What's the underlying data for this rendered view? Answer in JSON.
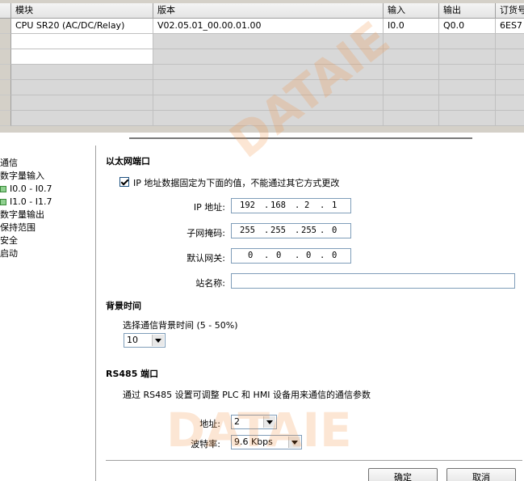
{
  "grid": {
    "headers": [
      "模块",
      "版本",
      "输入",
      "输出",
      "订货号"
    ],
    "rows": [
      [
        "CPU SR20 (AC/DC/Relay)",
        "V02.05.01_00.00.01.00",
        "I0.0",
        "Q0.0",
        "6ES7"
      ],
      [
        "",
        "",
        "",
        "",
        ""
      ],
      [
        "",
        "",
        "",
        "",
        ""
      ],
      [
        "",
        "",
        "",
        "",
        ""
      ],
      [
        "",
        "",
        "",
        "",
        ""
      ],
      [
        "",
        "",
        "",
        "",
        ""
      ],
      [
        "",
        "",
        "",
        "",
        ""
      ]
    ]
  },
  "tree": {
    "items": [
      "通信",
      "数字量输入",
      "I0.0 - I0.7",
      "I1.0 - I1.7",
      "数字量输出",
      "保持范围",
      "安全",
      "启动"
    ]
  },
  "ethernet": {
    "title": "以太网端口",
    "fixed_ip_label": "IP 地址数据固定为下面的值，不能通过其它方式更改",
    "fixed_ip_checked": true,
    "ip_label": "IP 地址:",
    "ip": [
      "192",
      "168",
      "2",
      "1"
    ],
    "subnet_label": "子网掩码:",
    "subnet": [
      "255",
      "255",
      "255",
      "0"
    ],
    "gateway_label": "默认网关:",
    "gateway": [
      "0",
      "0",
      "0",
      "0"
    ],
    "station_label": "站名称:",
    "station_value": ""
  },
  "background": {
    "title": "背景时间",
    "select_label": "选择通信背景时间 (5 - 50%)",
    "value": "10"
  },
  "rs485": {
    "title": "RS485 端口",
    "desc": "通过 RS485 设置可调整 PLC 和 HMI 设备用来通信的通信参数",
    "address_label": "地址:",
    "address_value": "2",
    "baud_label": "波特率:",
    "baud_value": "9.6 Kbps"
  },
  "buttons": {
    "ok": "确定",
    "cancel": "取消"
  },
  "watermark": "DATAIE"
}
